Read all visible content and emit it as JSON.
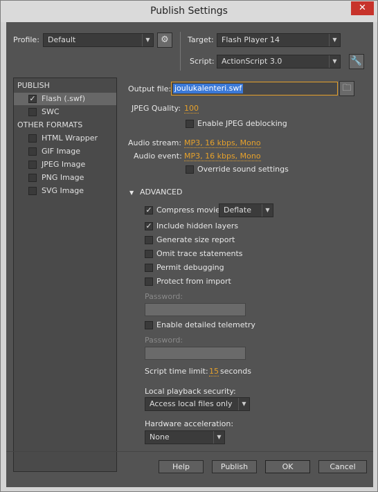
{
  "window": {
    "title": "Publish Settings",
    "close_glyph": "✕"
  },
  "header": {
    "profile_label": "Profile:",
    "profile_value": "Default",
    "target_label": "Target:",
    "target_value": "Flash Player 14",
    "script_label": "Script:",
    "script_value": "ActionScript 3.0"
  },
  "sidebar": {
    "publish_heading": "PUBLISH",
    "other_heading": "OTHER FORMATS",
    "publish_items": [
      {
        "label": "Flash (.swf)",
        "checked": true,
        "selected": true
      },
      {
        "label": "SWC",
        "checked": false,
        "selected": false
      }
    ],
    "other_items": [
      {
        "label": "HTML Wrapper",
        "checked": false
      },
      {
        "label": "GIF Image",
        "checked": false
      },
      {
        "label": "JPEG Image",
        "checked": false
      },
      {
        "label": "PNG Image",
        "checked": false
      },
      {
        "label": "SVG Image",
        "checked": false
      }
    ]
  },
  "main": {
    "output_file_label": "Output file:",
    "output_file_value": "joulukalenteri.swf",
    "jpeg_quality_label": "JPEG Quality:",
    "jpeg_quality_value": "100",
    "jpeg_deblocking_label": "Enable JPEG deblocking",
    "audio_stream_label": "Audio stream:",
    "audio_stream_value": "MP3, 16 kbps, Mono",
    "audio_event_label": "Audio event:",
    "audio_event_value": "MP3, 16 kbps, Mono",
    "override_sound_label": "Override sound settings",
    "advanced_label": "ADVANCED",
    "compress_movie_label": "Compress movie",
    "compress_value": "Deflate",
    "include_hidden_label": "Include hidden layers",
    "generate_report_label": "Generate size report",
    "omit_trace_label": "Omit trace statements",
    "permit_debugging_label": "Permit debugging",
    "protect_import_label": "Protect from import",
    "password_label": "Password:",
    "telemetry_label": "Enable detailed telemetry",
    "password2_label": "Password:",
    "script_time_label": "Script time limit:",
    "script_time_value": "15",
    "script_time_unit": "seconds",
    "local_playback_label": "Local playback security:",
    "local_playback_value": "Access local files only",
    "hw_accel_label": "Hardware acceleration:",
    "hw_accel_value": "None"
  },
  "footer": {
    "help": "Help",
    "publish": "Publish",
    "ok": "OK",
    "cancel": "Cancel"
  }
}
